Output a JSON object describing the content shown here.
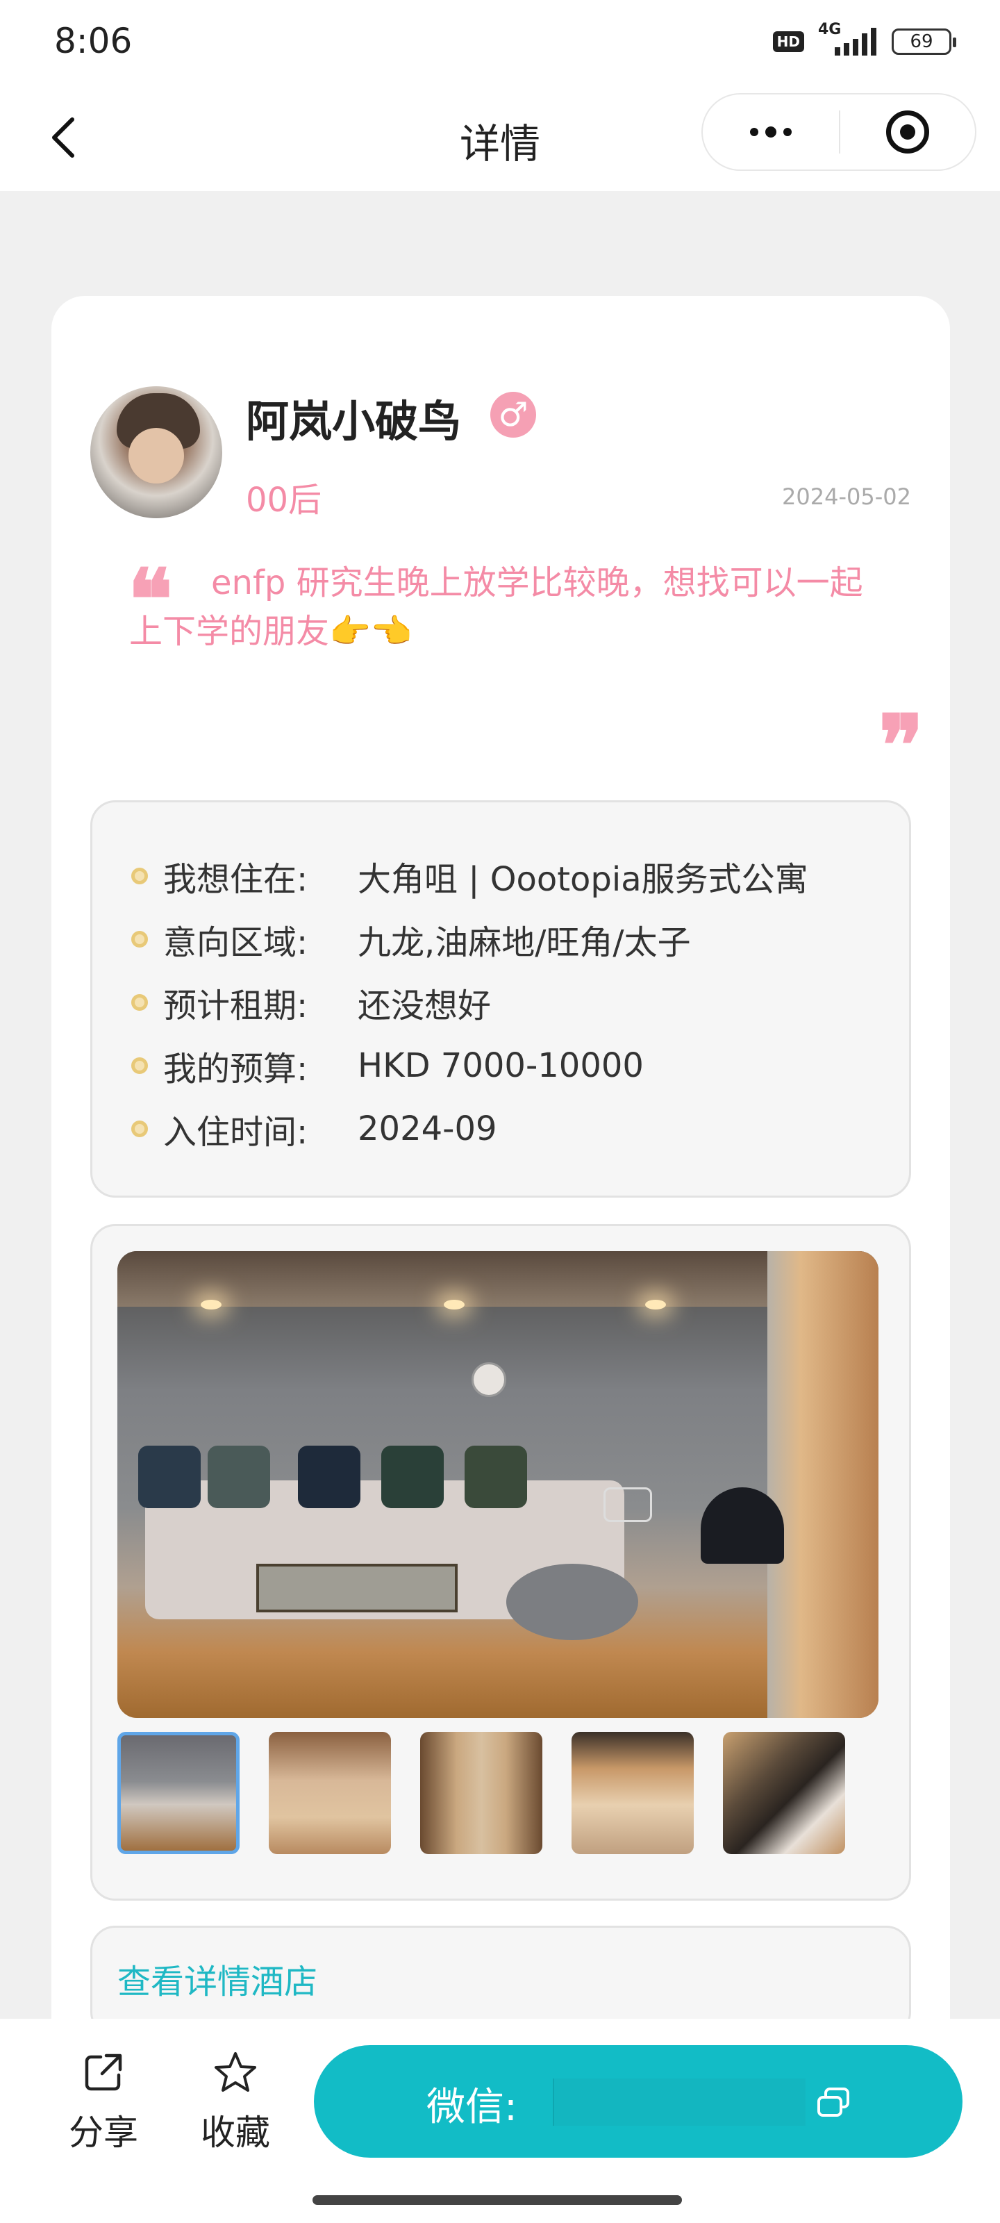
{
  "status_bar": {
    "time": "8:06",
    "hd": "HD",
    "network": "4G",
    "battery": "69"
  },
  "nav": {
    "title": "详情",
    "icons": [
      "back-arrow-icon",
      "more-dots-icon",
      "close-target-icon"
    ]
  },
  "profile": {
    "name": "阿岚小破鸟",
    "gender_symbol": "♂",
    "age_tag": "00后",
    "date": "2024-05-02",
    "quote": "enfp 研究生晚上放学比较晚，想找可以一起上下学的朋友👉👈",
    "quote_open": "❝",
    "quote_close": "❞"
  },
  "info": {
    "rows": [
      {
        "label": "我想住在:",
        "value": "大角咀 | Oootopia服务式公寓"
      },
      {
        "label": "意向区域:",
        "value": "九龙,油麻地/旺角/太子"
      },
      {
        "label": "预计租期:",
        "value": "还没想好"
      },
      {
        "label": "我的预算:",
        "value": "HKD 7000-10000"
      },
      {
        "label": "入住时间:",
        "value": "2024-09"
      }
    ]
  },
  "gallery": {
    "selected_index": 0,
    "thumb_count": 5
  },
  "hotel_link": "查看详情酒店",
  "bottom": {
    "share_label": "分享",
    "favorite_label": "收藏",
    "wechat_label": "微信:",
    "wechat_value": ""
  },
  "colors": {
    "accent_teal": "#12bcc6",
    "pink": "#f48ba6",
    "link": "#1fb8c4"
  }
}
